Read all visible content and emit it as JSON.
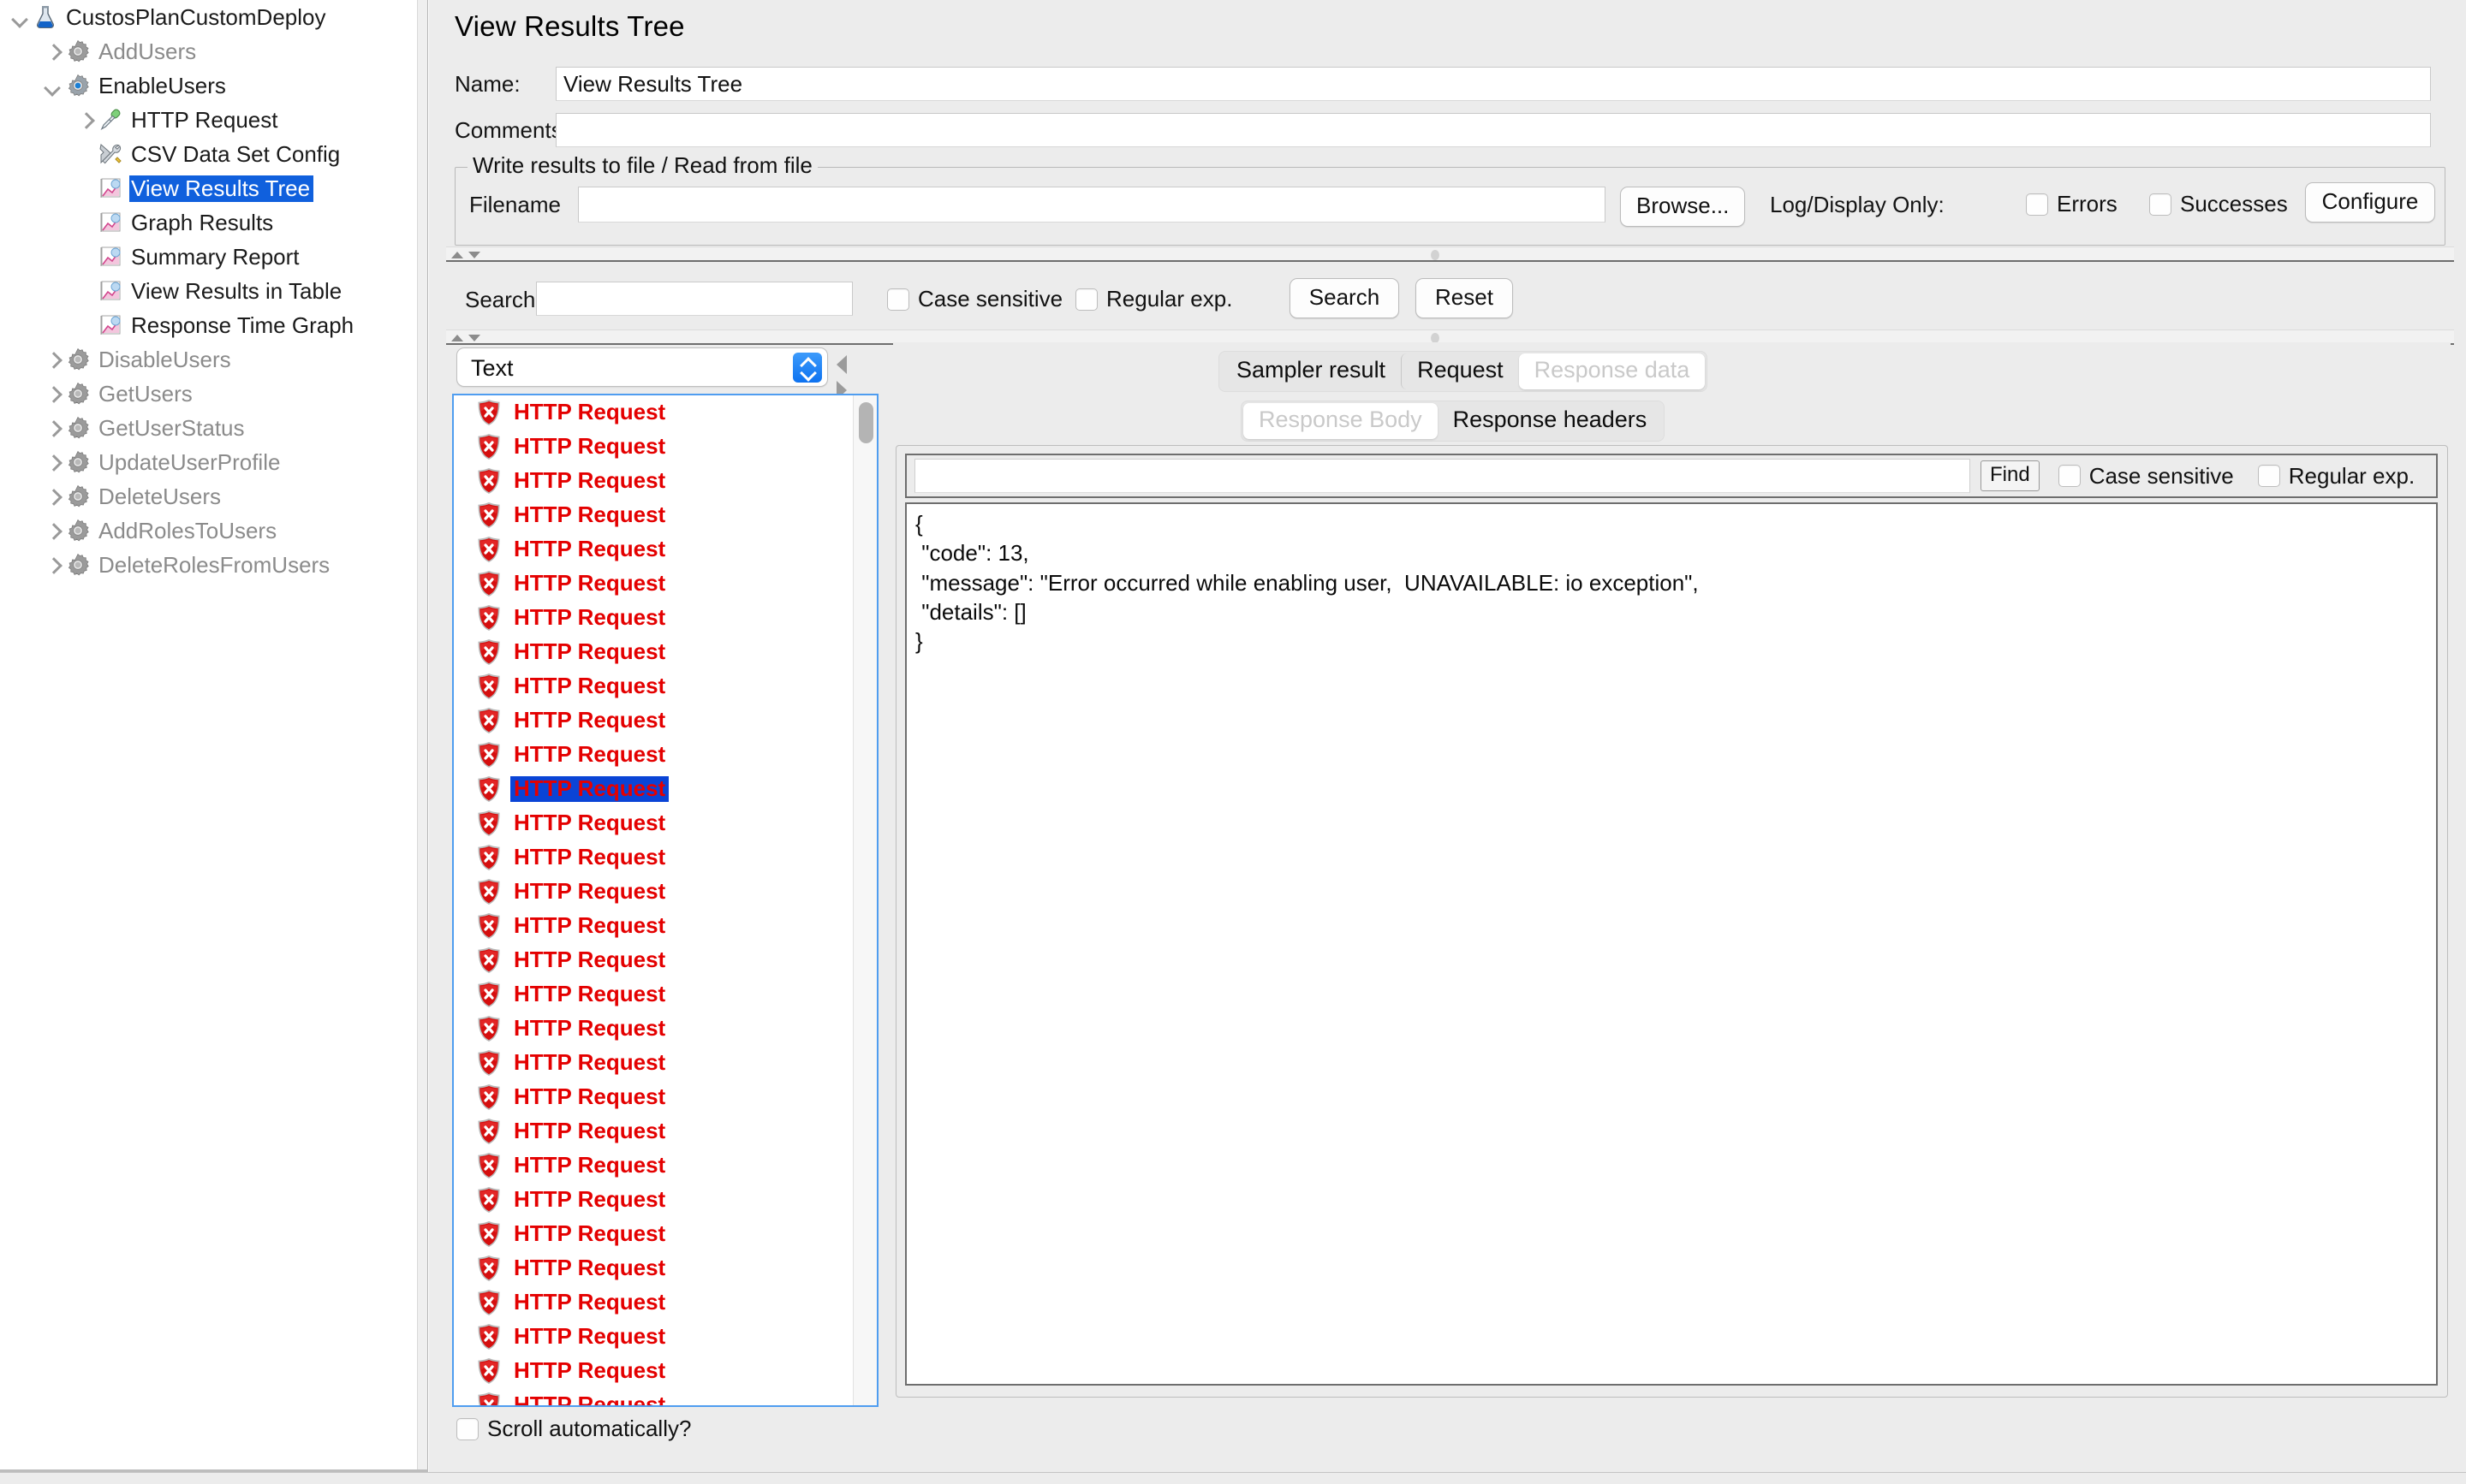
{
  "tree": {
    "items": [
      {
        "label": "CustosPlanCustomDeploy",
        "icon": "flask-icon",
        "depth": 0,
        "toggle": "chev-down",
        "state": "normal"
      },
      {
        "label": "AddUsers",
        "icon": "gear-icon",
        "depth": 1,
        "toggle": "chev-right",
        "state": "disabled"
      },
      {
        "label": "EnableUsers",
        "icon": "gear-on-icon",
        "depth": 1,
        "toggle": "chev-down",
        "state": "normal"
      },
      {
        "label": "HTTP Request",
        "icon": "pipette-icon",
        "depth": 2,
        "toggle": "chev-right",
        "state": "normal"
      },
      {
        "label": "CSV Data Set Config",
        "icon": "tools-icon",
        "depth": 2,
        "toggle": "none",
        "state": "normal"
      },
      {
        "label": "View Results Tree",
        "icon": "chart-icon",
        "depth": 2,
        "toggle": "none",
        "state": "selected"
      },
      {
        "label": "Graph Results",
        "icon": "chart-icon",
        "depth": 2,
        "toggle": "none",
        "state": "normal"
      },
      {
        "label": "Summary Report",
        "icon": "chart-icon",
        "depth": 2,
        "toggle": "none",
        "state": "normal"
      },
      {
        "label": "View Results in Table",
        "icon": "chart-icon",
        "depth": 2,
        "toggle": "none",
        "state": "normal"
      },
      {
        "label": "Response Time Graph",
        "icon": "chart-icon",
        "depth": 2,
        "toggle": "none",
        "state": "normal"
      },
      {
        "label": "DisableUsers",
        "icon": "gear-icon",
        "depth": 1,
        "toggle": "chev-right",
        "state": "disabled"
      },
      {
        "label": "GetUsers",
        "icon": "gear-icon",
        "depth": 1,
        "toggle": "chev-right",
        "state": "disabled"
      },
      {
        "label": "GetUserStatus",
        "icon": "gear-icon",
        "depth": 1,
        "toggle": "chev-right",
        "state": "disabled"
      },
      {
        "label": "UpdateUserProfile",
        "icon": "gear-icon",
        "depth": 1,
        "toggle": "chev-right",
        "state": "disabled"
      },
      {
        "label": "DeleteUsers",
        "icon": "gear-icon",
        "depth": 1,
        "toggle": "chev-right",
        "state": "disabled"
      },
      {
        "label": "AddRolesToUsers",
        "icon": "gear-icon",
        "depth": 1,
        "toggle": "chev-right",
        "state": "disabled"
      },
      {
        "label": "DeleteRolesFromUsers",
        "icon": "gear-icon",
        "depth": 1,
        "toggle": "chev-right",
        "state": "disabled"
      }
    ]
  },
  "panel": {
    "title": "View Results Tree",
    "name_label": "Name:",
    "name_value": "View Results Tree",
    "comments_label": "Comments:",
    "comments_value": ""
  },
  "file_group": {
    "title": "Write results to file / Read from file",
    "filename_label": "Filename",
    "filename_value": "",
    "browse_label": "Browse...",
    "logdisplay_label": "Log/Display Only:",
    "errors_label": "Errors",
    "errors_checked": false,
    "successes_label": "Successes",
    "successes_checked": false,
    "configure_label": "Configure"
  },
  "search_strip": {
    "search_label": "Search:",
    "search_value": "",
    "case_sensitive_label": "Case sensitive",
    "case_sensitive_checked": false,
    "regex_label": "Regular exp.",
    "regex_checked": false,
    "search_button": "Search",
    "reset_button": "Reset"
  },
  "results": {
    "renderer_selected": "Text",
    "scroll_auto_label": "Scroll automatically?",
    "scroll_auto_checked": false,
    "selected_index": 11,
    "entries": [
      {
        "label": "HTTP Request",
        "status": "error"
      },
      {
        "label": "HTTP Request",
        "status": "error"
      },
      {
        "label": "HTTP Request",
        "status": "error"
      },
      {
        "label": "HTTP Request",
        "status": "error"
      },
      {
        "label": "HTTP Request",
        "status": "error"
      },
      {
        "label": "HTTP Request",
        "status": "error"
      },
      {
        "label": "HTTP Request",
        "status": "error"
      },
      {
        "label": "HTTP Request",
        "status": "error"
      },
      {
        "label": "HTTP Request",
        "status": "error"
      },
      {
        "label": "HTTP Request",
        "status": "error"
      },
      {
        "label": "HTTP Request",
        "status": "error"
      },
      {
        "label": "HTTP Request",
        "status": "error"
      },
      {
        "label": "HTTP Request",
        "status": "error"
      },
      {
        "label": "HTTP Request",
        "status": "error"
      },
      {
        "label": "HTTP Request",
        "status": "error"
      },
      {
        "label": "HTTP Request",
        "status": "error"
      },
      {
        "label": "HTTP Request",
        "status": "error"
      },
      {
        "label": "HTTP Request",
        "status": "error"
      },
      {
        "label": "HTTP Request",
        "status": "error"
      },
      {
        "label": "HTTP Request",
        "status": "error"
      },
      {
        "label": "HTTP Request",
        "status": "error"
      },
      {
        "label": "HTTP Request",
        "status": "error"
      },
      {
        "label": "HTTP Request",
        "status": "error"
      },
      {
        "label": "HTTP Request",
        "status": "error"
      },
      {
        "label": "HTTP Request",
        "status": "error"
      },
      {
        "label": "HTTP Request",
        "status": "error"
      },
      {
        "label": "HTTP Request",
        "status": "error"
      },
      {
        "label": "HTTP Request",
        "status": "error"
      },
      {
        "label": "HTTP Request",
        "status": "error"
      },
      {
        "label": "HTTP Request",
        "status": "error"
      }
    ]
  },
  "detail": {
    "primary_tabs": [
      {
        "label": "Sampler result",
        "active": false
      },
      {
        "label": "Request",
        "active": false
      },
      {
        "label": "Response data",
        "active": true
      }
    ],
    "secondary_tabs": [
      {
        "label": "Response Body",
        "active": true
      },
      {
        "label": "Response headers",
        "active": false
      }
    ],
    "find": {
      "value": "",
      "find_button": "Find",
      "case_sensitive_label": "Case sensitive",
      "case_sensitive_checked": false,
      "regex_label": "Regular exp.",
      "regex_checked": false
    },
    "response_body_lines": [
      "{",
      " \"code\": 13,",
      " \"message\": \"Error occurred while enabling user,  UNAVAILABLE: io exception\",",
      " \"details\": []",
      "}"
    ]
  },
  "colors": {
    "selection_blue": "#1060dd",
    "list_selection_blue": "#0a44d6",
    "error_red": "#e40000",
    "panel_bg": "#ececec",
    "focus_border": "#4f9df0"
  }
}
